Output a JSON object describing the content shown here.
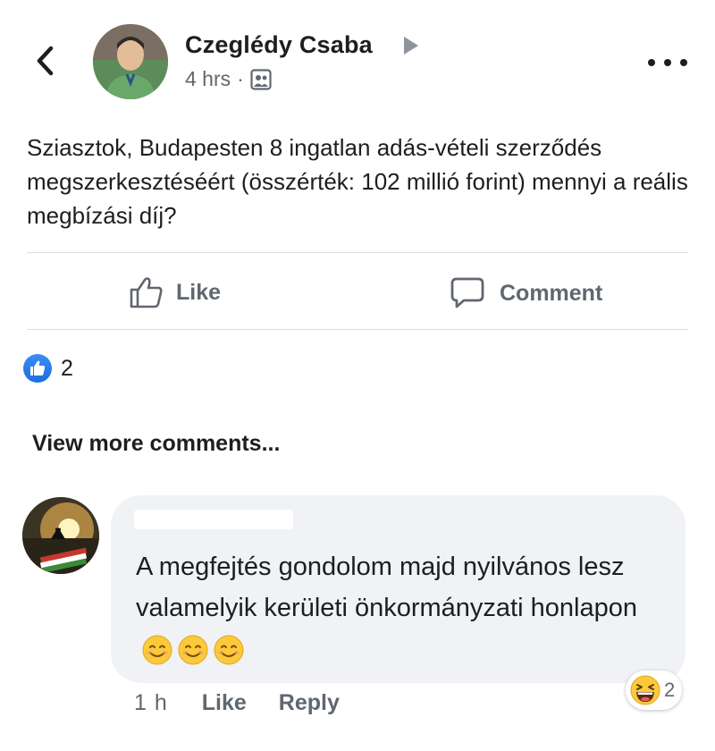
{
  "post": {
    "author": "Czeglédy Csaba",
    "time": "4 hrs",
    "privacy_icon": "group-audience-icon",
    "separator": "·",
    "text": "Sziasztok, Budapesten 8 ingatlan adás-vételi szerződés megszerkesztéséért (összérték: 102 millió forint) mennyi a reális megbízási díj?",
    "reaction_count": "2"
  },
  "actions": {
    "like_label": "Like",
    "comment_label": "Comment"
  },
  "comments": {
    "view_more_label": "View more comments...",
    "items": [
      {
        "text": "A megfejtés gondolom majd nyilvános lesz valamelyik kerületi önkormányzati honlapon",
        "emojis": [
          "smiling-face-icon",
          "smiling-face-icon",
          "smiling-face-icon"
        ],
        "time": "1 h",
        "like_label": "Like",
        "reply_label": "Reply",
        "reaction_emoji": "laughing-face-icon",
        "reaction_count": "2"
      }
    ]
  },
  "colors": {
    "text_primary": "#1c1e21",
    "text_secondary": "#606770",
    "divider": "#dadde1",
    "bubble_bg": "#f0f2f5",
    "like_blue": "#1a6fe0"
  }
}
